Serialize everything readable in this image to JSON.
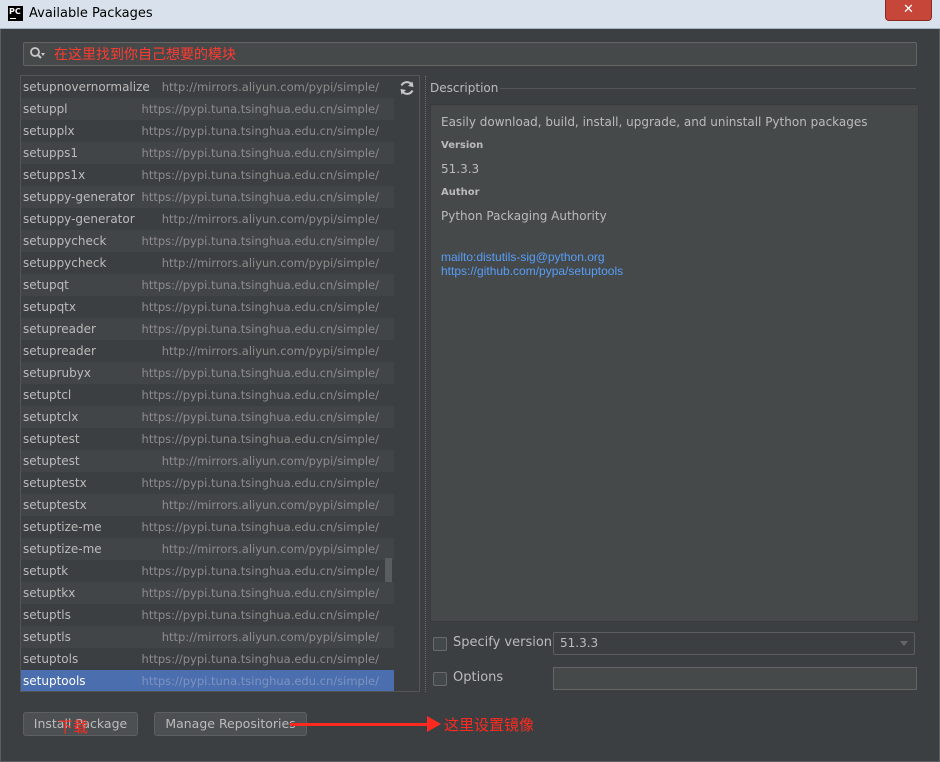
{
  "window": {
    "app_icon": "PC",
    "title": "Available Packages",
    "close_label": "✕"
  },
  "search": {
    "placeholder": "在这里找到你自己想要的模块"
  },
  "packages": [
    {
      "name": "setupnovernormalize",
      "repo": "http://mirrors.aliyun.com/pypi/simple/"
    },
    {
      "name": "setuppl",
      "repo": "https://pypi.tuna.tsinghua.edu.cn/simple/"
    },
    {
      "name": "setupplx",
      "repo": "https://pypi.tuna.tsinghua.edu.cn/simple/"
    },
    {
      "name": "setupps1",
      "repo": "https://pypi.tuna.tsinghua.edu.cn/simple/"
    },
    {
      "name": "setupps1x",
      "repo": "https://pypi.tuna.tsinghua.edu.cn/simple/"
    },
    {
      "name": "setuppy-generator",
      "repo": "https://pypi.tuna.tsinghua.edu.cn/simple/"
    },
    {
      "name": "setuppy-generator",
      "repo": "http://mirrors.aliyun.com/pypi/simple/"
    },
    {
      "name": "setuppycheck",
      "repo": "https://pypi.tuna.tsinghua.edu.cn/simple/"
    },
    {
      "name": "setuppycheck",
      "repo": "http://mirrors.aliyun.com/pypi/simple/"
    },
    {
      "name": "setupqt",
      "repo": "https://pypi.tuna.tsinghua.edu.cn/simple/"
    },
    {
      "name": "setupqtx",
      "repo": "https://pypi.tuna.tsinghua.edu.cn/simple/"
    },
    {
      "name": "setupreader",
      "repo": "https://pypi.tuna.tsinghua.edu.cn/simple/"
    },
    {
      "name": "setupreader",
      "repo": "http://mirrors.aliyun.com/pypi/simple/"
    },
    {
      "name": "setuprubyx",
      "repo": "https://pypi.tuna.tsinghua.edu.cn/simple/"
    },
    {
      "name": "setuptcl",
      "repo": "https://pypi.tuna.tsinghua.edu.cn/simple/"
    },
    {
      "name": "setuptclx",
      "repo": "https://pypi.tuna.tsinghua.edu.cn/simple/"
    },
    {
      "name": "setuptest",
      "repo": "https://pypi.tuna.tsinghua.edu.cn/simple/"
    },
    {
      "name": "setuptest",
      "repo": "http://mirrors.aliyun.com/pypi/simple/"
    },
    {
      "name": "setuptestx",
      "repo": "https://pypi.tuna.tsinghua.edu.cn/simple/"
    },
    {
      "name": "setuptestx",
      "repo": "http://mirrors.aliyun.com/pypi/simple/"
    },
    {
      "name": "setuptize-me",
      "repo": "https://pypi.tuna.tsinghua.edu.cn/simple/"
    },
    {
      "name": "setuptize-me",
      "repo": "http://mirrors.aliyun.com/pypi/simple/"
    },
    {
      "name": "setuptk",
      "repo": "https://pypi.tuna.tsinghua.edu.cn/simple/"
    },
    {
      "name": "setuptkx",
      "repo": "https://pypi.tuna.tsinghua.edu.cn/simple/"
    },
    {
      "name": "setuptls",
      "repo": "https://pypi.tuna.tsinghua.edu.cn/simple/"
    },
    {
      "name": "setuptls",
      "repo": "http://mirrors.aliyun.com/pypi/simple/"
    },
    {
      "name": "setuptols",
      "repo": "https://pypi.tuna.tsinghua.edu.cn/simple/"
    },
    {
      "name": "setuptools",
      "repo": "https://pypi.tuna.tsinghua.edu.cn/simple/",
      "selected": true
    }
  ],
  "description": {
    "label": "Description",
    "summary": "Easily download, build, install, upgrade, and uninstall Python packages",
    "version_heading": "Version",
    "version": "51.3.3",
    "author_heading": "Author",
    "author": "Python Packaging Authority",
    "link_email": "mailto:distutils-sig@python.org",
    "link_home": "https://github.com/pypa/setuptools"
  },
  "options": {
    "specify_version_label": "Specify version",
    "version_value": "51.3.3",
    "options_label": "Options",
    "options_value": ""
  },
  "buttons": {
    "install": "Install Package",
    "manage": "Manage Repositories"
  },
  "annotations": {
    "install_note": "下载",
    "repo_note": "这里设置镜像"
  },
  "colors": {
    "selection": "#4b6eaf",
    "link": "#589df6",
    "annotation": "#ff2a1f"
  }
}
